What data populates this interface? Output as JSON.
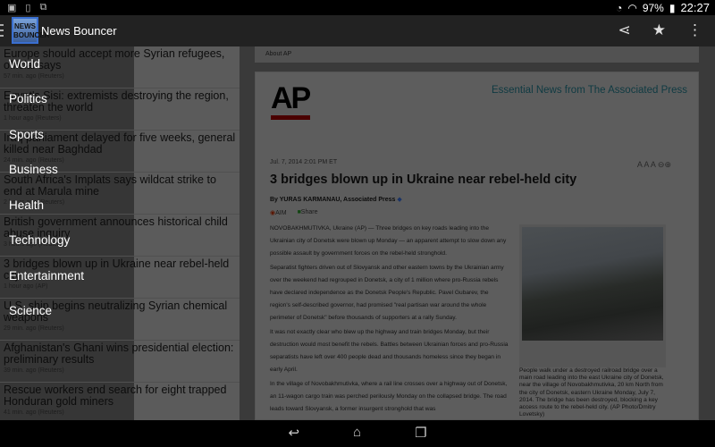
{
  "status": {
    "battery": "97%",
    "time": "22:27"
  },
  "app": {
    "title": "News Bouncer",
    "logo_text": "NEWS BOUNCER"
  },
  "list": [
    {
      "headline": "Europe should accept more Syrian refugees, official says",
      "time": "57 min. ago (Reuters)"
    },
    {
      "headline": "Egypt's Sisi: extremists destroying the region, threaten the world",
      "time": "1 hour ago (Reuters)"
    },
    {
      "headline": "Iraq parliament delayed for five weeks, general killed near Baghdad",
      "time": "24 min. ago (Reuters)"
    },
    {
      "headline": "South Africa's Implats says wildcat strike to end at Marula mine",
      "time": "2 hours ago (Reuters)"
    },
    {
      "headline": "British government announces historical child abuse inquiry",
      "time": "3 hours ago (Reuters)"
    },
    {
      "headline": "3 bridges blown up in Ukraine near rebel-held city",
      "time": "1 hour ago (AP)"
    },
    {
      "headline": "U.S. ship begins neutralizing Syrian chemical weapons",
      "time": "29 min. ago (Reuters)"
    },
    {
      "headline": "Afghanistan's Ghani wins presidential election: preliminary results",
      "time": "39 min. ago (Reuters)"
    },
    {
      "headline": "Rescue workers end search for eight trapped Honduran gold miners",
      "time": "41 min. ago (Reuters)"
    }
  ],
  "drawer": [
    "World",
    "Politics",
    "Sports",
    "Business",
    "Health",
    "Technology",
    "Entertainment",
    "Science"
  ],
  "article": {
    "about": "About AP",
    "ap_logo": "AP",
    "tagline": "Essential News from The Associated Press",
    "date": "Jul. 7, 2014 2:01 PM ET",
    "sizes": "A A A",
    "title": "3 bridges blown up in Ukraine near rebel-held city",
    "byline": "By YURAS KARMANAU, Associated Press",
    "aim": "AIM",
    "share": "Share",
    "paragraphs": [
      "NOVOBAKHMUTIVKA, Ukraine (AP) — Three bridges on key roads leading into the Ukrainian city of Donetsk were blown up Monday — an apparent attempt to slow down any possible assault by government forces on the rebel-held stronghold.",
      "Separatist fighters driven out of Slovyansk and other eastern towns by the Ukrainian army over the weekend had regrouped in Donetsk, a city of 1 million where pro-Russia rebels have declared independence as the Donetsk People's Republic. Pavel Gubarev, the region's self-described governor, had promised \"real partisan war around the whole perimeter of Donetsk\" before thousands of supporters at a rally Sunday.",
      "It was not exactly clear who blew up the highway and train bridges Monday, but their destruction would most benefit the rebels. Battles between Ukrainian forces and pro-Russia separatists have left over 400 people dead and thousands homeless since they began in early April.",
      "In the village of Novobakhmutivka, where a rail line crosses over a highway out of Donetsk, an 11-wagon cargo train was perched perilously Monday on the collapsed bridge. The road leads toward Slovyansk, a former insurgent stronghold that was"
    ],
    "caption": "People walk under a destroyed railroad bridge over a main road leading into the east Ukraine city of Donetsk, near the village of Novobakhmutivka, 20 km North from the city of Donetsk, eastern Ukraine Monday, July 7, 2014. The bridge has been destroyed, blocking a key access route to the rebel-held city. (AP Photo/Dmitry Lovetsky)"
  }
}
